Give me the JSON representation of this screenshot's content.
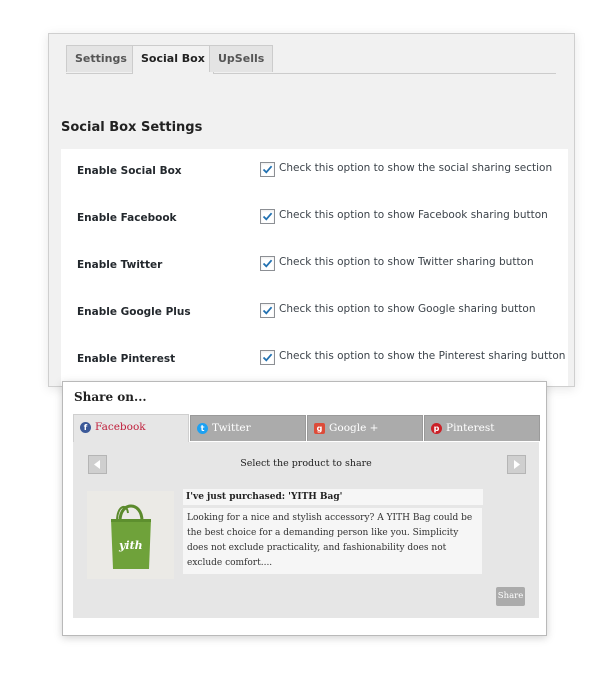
{
  "settings": {
    "tabs": [
      {
        "label": "Settings"
      },
      {
        "label": "Social Box"
      },
      {
        "label": "UpSells"
      }
    ],
    "section_title": "Social Box Settings",
    "options": [
      {
        "label": "Enable Social Box",
        "checked": true,
        "description": "Check this option to show the social sharing section"
      },
      {
        "label": "Enable Facebook",
        "checked": true,
        "description": "Check this option to show Facebook sharing button"
      },
      {
        "label": "Enable Twitter",
        "checked": true,
        "description": "Check this option to show Twitter sharing button"
      },
      {
        "label": "Enable Google Plus",
        "checked": true,
        "description": "Check this option to show Google sharing button"
      },
      {
        "label": "Enable Pinterest",
        "checked": true,
        "description": "Check this option to show the Pinterest sharing button"
      }
    ]
  },
  "share": {
    "title": "Share on...",
    "tabs": [
      {
        "label": "Facebook",
        "icon": "facebook-icon",
        "color": "#3b5998"
      },
      {
        "label": "Twitter",
        "icon": "twitter-icon",
        "color": "#1da1f2"
      },
      {
        "label": "Google +",
        "icon": "google-plus-icon",
        "color": "#dd4b39"
      },
      {
        "label": "Pinterest",
        "icon": "pinterest-icon",
        "color": "#cb2027"
      }
    ],
    "select_text": "Select the product to share",
    "product": {
      "headline": "I've just purchased: 'YITH Bag'",
      "description": "Looking for a nice and stylish accessory? A YITH Bag could be the best choice for a demanding person like you. Simplicity does not exclude practicality, and fashionability does not exclude comfort....",
      "image_text": "yith",
      "bag_color": "#6fa23a"
    },
    "share_button": "Share"
  }
}
